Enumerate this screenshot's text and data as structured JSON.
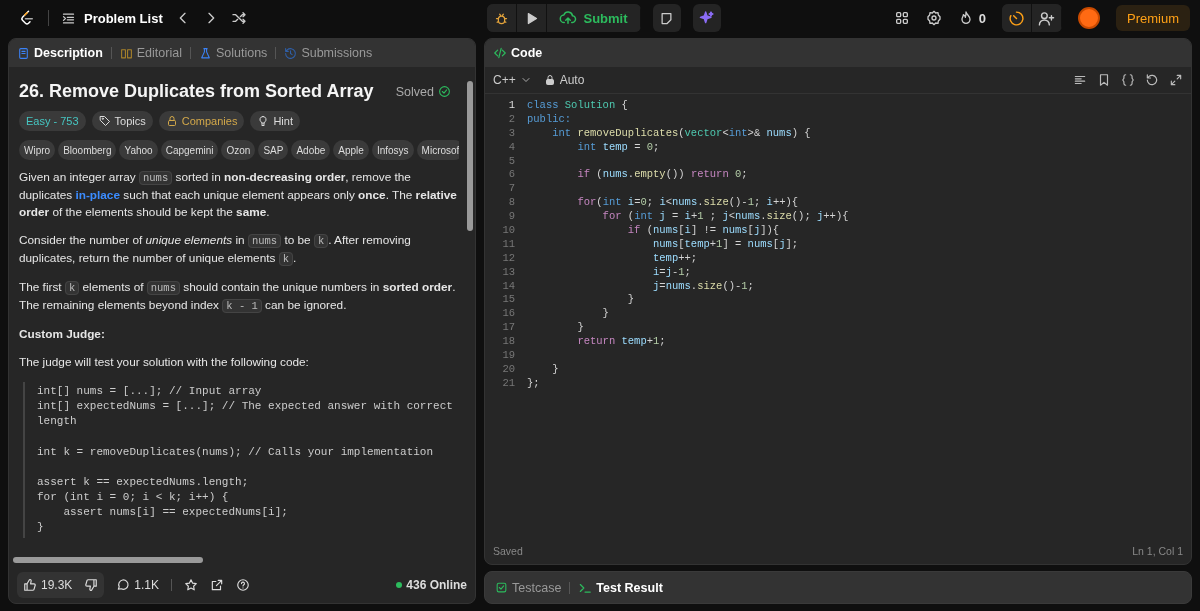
{
  "top_bar": {
    "problem_list": "Problem List",
    "submit": "Submit",
    "streak": "0",
    "premium": "Premium"
  },
  "description_panel": {
    "tabs": [
      {
        "label": "Description",
        "selected": true
      },
      {
        "label": "Editorial",
        "selected": false
      },
      {
        "label": "Solutions",
        "selected": false
      },
      {
        "label": "Submissions",
        "selected": false
      }
    ],
    "title": "26. Remove Duplicates from Sorted Array",
    "status": "Solved",
    "tags": [
      {
        "kind": "difficulty",
        "label": "Easy - 753"
      },
      {
        "kind": "topics",
        "label": "Topics"
      },
      {
        "kind": "companies",
        "label": "Companies"
      },
      {
        "kind": "hint",
        "label": "Hint"
      }
    ],
    "companies": [
      "Wipro",
      "Bloomberg",
      "Yahoo",
      "Capgemini",
      "Ozon",
      "SAP",
      "Adobe",
      "Apple",
      "Infosys",
      "Microsof"
    ],
    "blocks": [
      {
        "kind": "paragraph",
        "segments": [
          {
            "kind": "text",
            "text": "Given an integer array "
          },
          {
            "kind": "code",
            "text": "nums"
          },
          {
            "kind": "text",
            "text": " sorted in **non-decreasing order**, remove the duplicates "
          },
          {
            "kind": "link",
            "text": "in-place"
          },
          {
            "kind": "text",
            "text": " such that each unique element appears only **once**. The **relative order** of the elements should be kept the **same**."
          }
        ]
      },
      {
        "kind": "paragraph",
        "segments": [
          {
            "kind": "text",
            "text": "Consider the number of *unique elements* in "
          },
          {
            "kind": "code",
            "text": "nums"
          },
          {
            "kind": "text",
            "text": " to be "
          },
          {
            "kind": "code",
            "text": "k"
          },
          {
            "kind": "text",
            "text": ". After removing duplicates, return the number of unique elements "
          },
          {
            "kind": "code",
            "text": "k"
          },
          {
            "kind": "text",
            "text": "."
          }
        ]
      },
      {
        "kind": "paragraph",
        "segments": [
          {
            "kind": "text",
            "text": "The first "
          },
          {
            "kind": "code",
            "text": "k"
          },
          {
            "kind": "text",
            "text": " elements of "
          },
          {
            "kind": "code",
            "text": "nums"
          },
          {
            "kind": "text",
            "text": " should contain the unique numbers in **sorted order**. The remaining elements beyond index "
          },
          {
            "kind": "code",
            "text": "k - 1"
          },
          {
            "kind": "text",
            "text": " can be ignored."
          }
        ]
      },
      {
        "kind": "heading",
        "text": "Custom Judge:"
      },
      {
        "kind": "paragraph",
        "segments": [
          {
            "kind": "text",
            "text": "The judge will test your solution with the following code:"
          }
        ]
      },
      {
        "kind": "code",
        "groups": [
          [
            "int[] nums = [...]; // Input array",
            "int[] expectedNums = [...]; // The expected answer with correct length"
          ],
          [
            "int k = removeDuplicates(nums); // Calls your implementation"
          ],
          [
            "assert k == expectedNums.length;",
            "for (int i = 0; i < k; i++) {",
            "    assert nums[i] == expectedNums[i];",
            "}"
          ]
        ]
      }
    ],
    "footer": {
      "likes": "19.3K",
      "comments": "1.1K",
      "online": "436 Online"
    }
  },
  "code_panel": {
    "title": "Code",
    "language": "C++",
    "mode": "Auto",
    "lines": [
      {
        "n": "1",
        "tokens": [
          {
            "kind": "k",
            "text": "class "
          },
          {
            "kind": "c",
            "text": "Solution"
          },
          {
            "kind": "p",
            "text": " {"
          }
        ]
      },
      {
        "n": "2",
        "tokens": [
          {
            "kind": "k",
            "text": "public:"
          }
        ]
      },
      {
        "n": "3",
        "tokens": [
          {
            "kind": "k",
            "text": "    int "
          },
          {
            "kind": "f",
            "text": "removeDuplicates"
          },
          {
            "kind": "p",
            "text": "("
          },
          {
            "kind": "c",
            "text": "vector"
          },
          {
            "kind": "p",
            "text": "<"
          },
          {
            "kind": "k",
            "text": "int"
          },
          {
            "kind": "p",
            "text": ">& "
          },
          {
            "kind": "v",
            "text": "nums"
          },
          {
            "kind": "p",
            "text": ") {"
          }
        ]
      },
      {
        "n": "4",
        "tokens": [
          {
            "kind": "k",
            "text": "        int "
          },
          {
            "kind": "v",
            "text": "temp"
          },
          {
            "kind": "p",
            "text": " = "
          },
          {
            "kind": "n",
            "text": "0"
          },
          {
            "kind": "p",
            "text": ";"
          }
        ]
      },
      {
        "n": "5"
      },
      {
        "n": "6",
        "tokens": [
          {
            "kind": "x",
            "text": "        if"
          },
          {
            "kind": "p",
            "text": " ("
          },
          {
            "kind": "v",
            "text": "nums"
          },
          {
            "kind": "p",
            "text": "."
          },
          {
            "kind": "f",
            "text": "empty"
          },
          {
            "kind": "p",
            "text": "()) "
          },
          {
            "kind": "x",
            "text": "return "
          },
          {
            "kind": "n",
            "text": "0"
          },
          {
            "kind": "p",
            "text": ";"
          }
        ]
      },
      {
        "n": "7"
      },
      {
        "n": "8",
        "tokens": [
          {
            "kind": "x",
            "text": "        for"
          },
          {
            "kind": "p",
            "text": "("
          },
          {
            "kind": "k",
            "text": "int "
          },
          {
            "kind": "v",
            "text": "i"
          },
          {
            "kind": "p",
            "text": "="
          },
          {
            "kind": "n",
            "text": "0"
          },
          {
            "kind": "p",
            "text": "; "
          },
          {
            "kind": "v",
            "text": "i"
          },
          {
            "kind": "p",
            "text": "<"
          },
          {
            "kind": "v",
            "text": "nums"
          },
          {
            "kind": "p",
            "text": "."
          },
          {
            "kind": "f",
            "text": "size"
          },
          {
            "kind": "p",
            "text": "()-"
          },
          {
            "kind": "n",
            "text": "1"
          },
          {
            "kind": "p",
            "text": "; "
          },
          {
            "kind": "v",
            "text": "i"
          },
          {
            "kind": "p",
            "text": "++){"
          }
        ]
      },
      {
        "n": "9",
        "tokens": [
          {
            "kind": "x",
            "text": "            for"
          },
          {
            "kind": "p",
            "text": " ("
          },
          {
            "kind": "k",
            "text": "int "
          },
          {
            "kind": "v",
            "text": "j"
          },
          {
            "kind": "p",
            "text": " = "
          },
          {
            "kind": "v",
            "text": "i"
          },
          {
            "kind": "p",
            "text": "+"
          },
          {
            "kind": "n",
            "text": "1"
          },
          {
            "kind": "p",
            "text": " ; "
          },
          {
            "kind": "v",
            "text": "j"
          },
          {
            "kind": "p",
            "text": "<"
          },
          {
            "kind": "v",
            "text": "nums"
          },
          {
            "kind": "p",
            "text": "."
          },
          {
            "kind": "f",
            "text": "size"
          },
          {
            "kind": "p",
            "text": "(); "
          },
          {
            "kind": "v",
            "text": "j"
          },
          {
            "kind": "p",
            "text": "++){"
          }
        ]
      },
      {
        "n": "10",
        "tokens": [
          {
            "kind": "x",
            "text": "                if"
          },
          {
            "kind": "p",
            "text": " ("
          },
          {
            "kind": "v",
            "text": "nums"
          },
          {
            "kind": "p",
            "text": "["
          },
          {
            "kind": "v",
            "text": "i"
          },
          {
            "kind": "p",
            "text": "] != "
          },
          {
            "kind": "v",
            "text": "nums"
          },
          {
            "kind": "p",
            "text": "["
          },
          {
            "kind": "v",
            "text": "j"
          },
          {
            "kind": "p",
            "text": "]){"
          }
        ]
      },
      {
        "n": "11",
        "tokens": [
          {
            "kind": "v",
            "text": "                    nums"
          },
          {
            "kind": "p",
            "text": "["
          },
          {
            "kind": "v",
            "text": "temp"
          },
          {
            "kind": "p",
            "text": "+"
          },
          {
            "kind": "n",
            "text": "1"
          },
          {
            "kind": "p",
            "text": "] = "
          },
          {
            "kind": "v",
            "text": "nums"
          },
          {
            "kind": "p",
            "text": "["
          },
          {
            "kind": "v",
            "text": "j"
          },
          {
            "kind": "p",
            "text": "];"
          }
        ]
      },
      {
        "n": "12",
        "tokens": [
          {
            "kind": "v",
            "text": "                    temp"
          },
          {
            "kind": "p",
            "text": "++;"
          }
        ]
      },
      {
        "n": "13",
        "tokens": [
          {
            "kind": "v",
            "text": "                    i"
          },
          {
            "kind": "p",
            "text": "="
          },
          {
            "kind": "v",
            "text": "j"
          },
          {
            "kind": "p",
            "text": "-"
          },
          {
            "kind": "n",
            "text": "1"
          },
          {
            "kind": "p",
            "text": ";"
          }
        ]
      },
      {
        "n": "14",
        "tokens": [
          {
            "kind": "v",
            "text": "                    j"
          },
          {
            "kind": "p",
            "text": "="
          },
          {
            "kind": "v",
            "text": "nums"
          },
          {
            "kind": "p",
            "text": "."
          },
          {
            "kind": "f",
            "text": "size"
          },
          {
            "kind": "p",
            "text": "()-"
          },
          {
            "kind": "n",
            "text": "1"
          },
          {
            "kind": "p",
            "text": ";"
          }
        ]
      },
      {
        "n": "15",
        "tokens": [
          {
            "kind": "p",
            "text": "                }"
          }
        ]
      },
      {
        "n": "16",
        "tokens": [
          {
            "kind": "p",
            "text": "            }"
          }
        ]
      },
      {
        "n": "17",
        "tokens": [
          {
            "kind": "p",
            "text": "        }"
          }
        ]
      },
      {
        "n": "18",
        "tokens": [
          {
            "kind": "x",
            "text": "        return "
          },
          {
            "kind": "v",
            "text": "temp"
          },
          {
            "kind": "p",
            "text": "+"
          },
          {
            "kind": "n",
            "text": "1"
          },
          {
            "kind": "p",
            "text": ";"
          }
        ]
      },
      {
        "n": "19"
      },
      {
        "n": "20",
        "tokens": [
          {
            "kind": "p",
            "text": "    }"
          }
        ]
      },
      {
        "n": "21",
        "tokens": [
          {
            "kind": "p",
            "text": "};"
          }
        ]
      }
    ],
    "status": "Saved",
    "cursor": "Ln 1, Col 1"
  },
  "bottom_panel": {
    "tabs": [
      {
        "label": "Testcase",
        "selected": false
      },
      {
        "label": "Test Result",
        "selected": true
      }
    ]
  }
}
